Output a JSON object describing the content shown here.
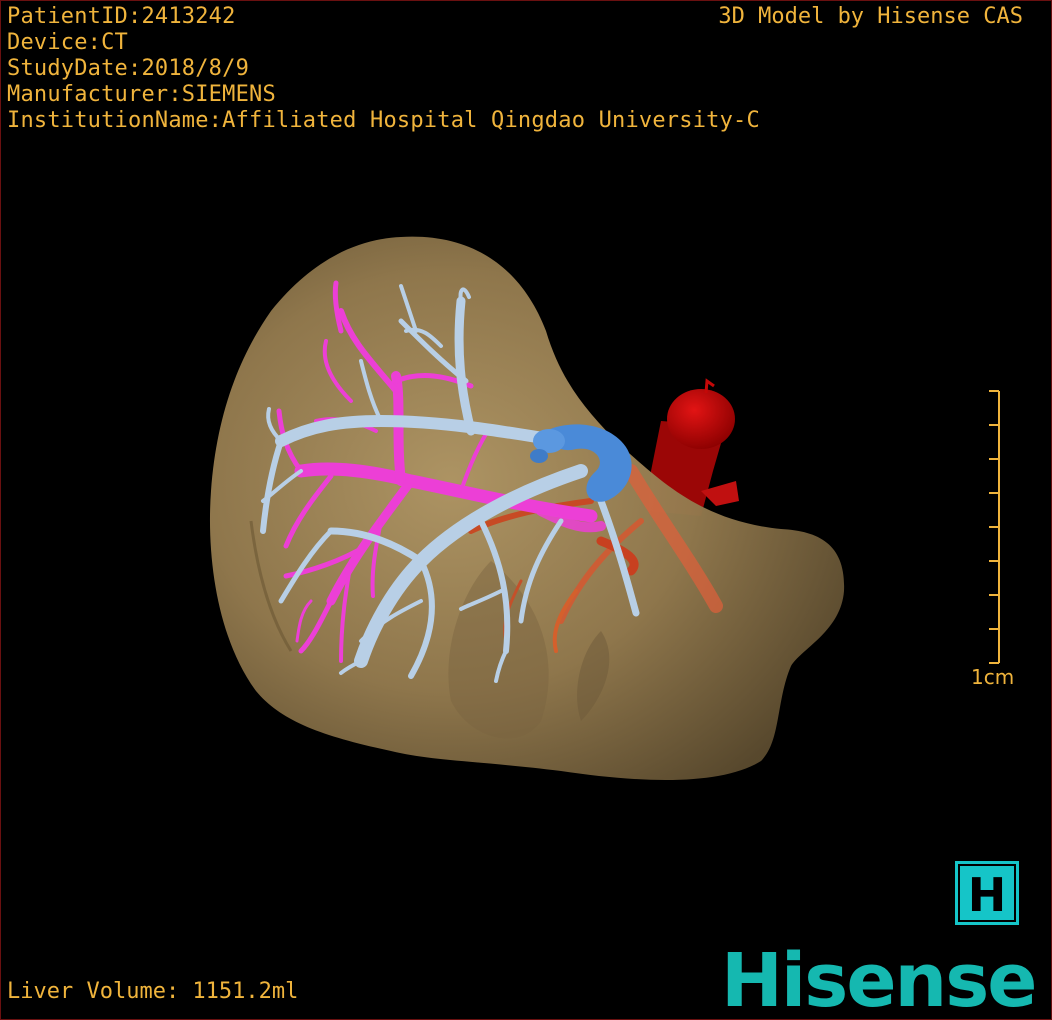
{
  "patient_info": {
    "patient_id": "PatientID:2413242",
    "device": "Device:CT",
    "study_date": "StudyDate:2018/8/9",
    "manufacturer": "Manufacturer:SIEMENS",
    "institution": "InstitutionName:Affiliated Hospital Qingdao University-C"
  },
  "model_credit": "3D Model by Hisense CAS",
  "liver_volume": "Liver Volume: 1151.2ml",
  "scale": {
    "label": "1cm",
    "tick_count": 9
  },
  "brand": {
    "logo_letter": "H",
    "name": "Hisense",
    "color": "#15b8b0"
  },
  "colors": {
    "overlay_text": "#f0b43c",
    "liver": "#9c8256",
    "hepatic_vein": "#b8cfe6",
    "portal_vein": "#ec3fd6",
    "vena_cava": "#4a8ad8",
    "aorta": "#c40808",
    "hepatic_artery": "#e0603a"
  },
  "icons": {
    "logo": "hisense-h-icon"
  }
}
